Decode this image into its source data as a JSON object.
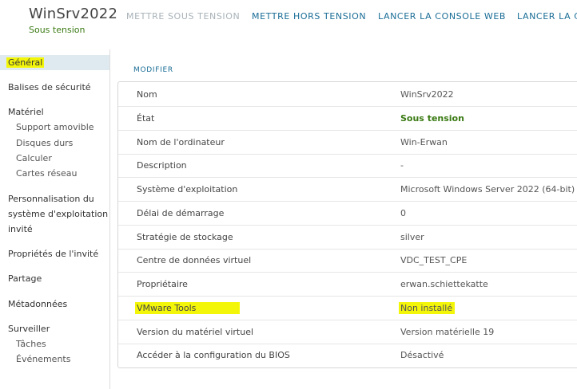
{
  "header": {
    "title": "WinSrv2022",
    "status": "Sous tension",
    "actions": [
      "METTRE SOUS TENSION",
      "METTRE HORS TENSION",
      "LANCER LA CONSOLE WEB",
      "LANCER LA C"
    ]
  },
  "sidebar": {
    "items": [
      "Général",
      "Balises de sécurité",
      "Matériel",
      "Support amovible",
      "Disques durs",
      "Calculer",
      "Cartes réseau",
      "Personnalisation du",
      "système d'exploitation",
      "invité",
      "Propriétés de l'invité",
      "Partage",
      "Métadonnées",
      "Surveiller",
      "Tâches",
      "Événements"
    ]
  },
  "main": {
    "modify_label": "MODIFIER",
    "rows": [
      {
        "key": "Nom",
        "value": "WinSrv2022"
      },
      {
        "key": "État",
        "value": "Sous tension"
      },
      {
        "key": "Nom de l'ordinateur",
        "value": "Win-Erwan"
      },
      {
        "key": "Description",
        "value": "-"
      },
      {
        "key": "Système d'exploitation",
        "value": "Microsoft Windows Server 2022 (64-bit)"
      },
      {
        "key": "Délai de démarrage",
        "value": "0"
      },
      {
        "key": "Stratégie de stockage",
        "value": "silver"
      },
      {
        "key": "Centre de données virtuel",
        "value": "VDC_TEST_CPE"
      },
      {
        "key": "Propriétaire",
        "value": "erwan.schiettekatte"
      },
      {
        "key": "VMware Tools",
        "value": "Non installé"
      },
      {
        "key": "Version du matériel virtuel",
        "value": "Version matérielle 19"
      },
      {
        "key": "Accéder à la configuration du BIOS",
        "value": "Désactivé"
      }
    ]
  },
  "colors": {
    "accent": "#1a6d96",
    "status_green": "#3a7a13",
    "highlight": "#f4f60a",
    "disabled": "#a8b2b8",
    "selected_bg": "#dfe9f0"
  }
}
